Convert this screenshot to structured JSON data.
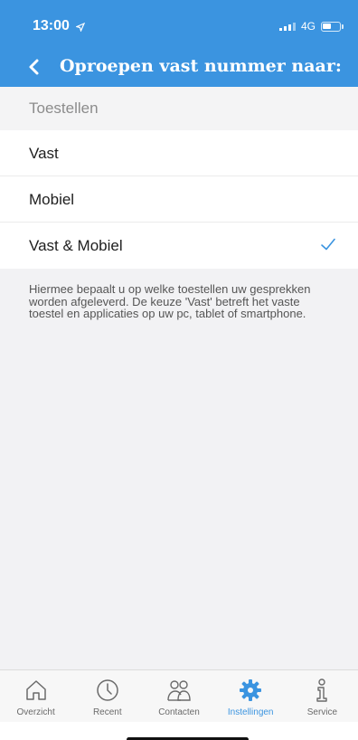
{
  "status_bar": {
    "time": "13:00",
    "network": "4G"
  },
  "nav": {
    "title": "Oproepen vast nummer naar:"
  },
  "section": {
    "header": "Toestellen"
  },
  "options": [
    {
      "label": "Vast",
      "selected": false
    },
    {
      "label": "Mobiel",
      "selected": false
    },
    {
      "label": "Vast & Mobiel",
      "selected": true
    }
  ],
  "description": "Hiermee bepaalt u op welke toestellen uw gesprekken worden afgeleverd. De keuze 'Vast' betreft het vaste toestel en applicaties op uw pc, tablet of smartphone.",
  "tabs": [
    {
      "label": "Overzicht",
      "icon": "home-icon",
      "active": false
    },
    {
      "label": "Recent",
      "icon": "clock-icon",
      "active": false
    },
    {
      "label": "Contacten",
      "icon": "contacts-icon",
      "active": false
    },
    {
      "label": "Instellingen",
      "icon": "gear-icon",
      "active": true
    },
    {
      "label": "Service",
      "icon": "info-icon",
      "active": false
    }
  ],
  "colors": {
    "accent": "#3b94e0",
    "background": "#f2f2f4",
    "tab_inactive": "#6a6a6a"
  }
}
